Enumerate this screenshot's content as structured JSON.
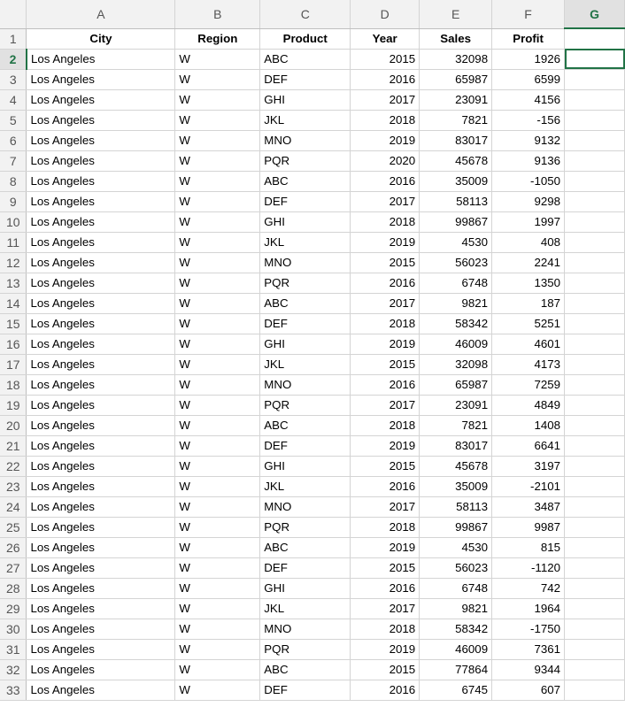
{
  "columns": [
    "A",
    "B",
    "C",
    "D",
    "E",
    "F",
    "G"
  ],
  "selected_column": "G",
  "selected_row": "2",
  "header": {
    "row": "1",
    "cells": [
      "City",
      "Region",
      "Product",
      "Year",
      "Sales",
      "Profit",
      ""
    ]
  },
  "rows": [
    {
      "n": "2",
      "cells": [
        "Los Angeles",
        "W",
        "ABC",
        "2015",
        "32098",
        "1926"
      ]
    },
    {
      "n": "3",
      "cells": [
        "Los Angeles",
        "W",
        "DEF",
        "2016",
        "65987",
        "6599"
      ]
    },
    {
      "n": "4",
      "cells": [
        "Los Angeles",
        "W",
        "GHI",
        "2017",
        "23091",
        "4156"
      ]
    },
    {
      "n": "5",
      "cells": [
        "Los Angeles",
        "W",
        "JKL",
        "2018",
        "7821",
        "-156"
      ]
    },
    {
      "n": "6",
      "cells": [
        "Los Angeles",
        "W",
        "MNO",
        "2019",
        "83017",
        "9132"
      ]
    },
    {
      "n": "7",
      "cells": [
        "Los Angeles",
        "W",
        "PQR",
        "2020",
        "45678",
        "9136"
      ]
    },
    {
      "n": "8",
      "cells": [
        "Los Angeles",
        "W",
        "ABC",
        "2016",
        "35009",
        "-1050"
      ]
    },
    {
      "n": "9",
      "cells": [
        "Los Angeles",
        "W",
        "DEF",
        "2017",
        "58113",
        "9298"
      ]
    },
    {
      "n": "10",
      "cells": [
        "Los Angeles",
        "W",
        "GHI",
        "2018",
        "99867",
        "1997"
      ]
    },
    {
      "n": "11",
      "cells": [
        "Los Angeles",
        "W",
        "JKL",
        "2019",
        "4530",
        "408"
      ]
    },
    {
      "n": "12",
      "cells": [
        "Los Angeles",
        "W",
        "MNO",
        "2015",
        "56023",
        "2241"
      ]
    },
    {
      "n": "13",
      "cells": [
        "Los Angeles",
        "W",
        "PQR",
        "2016",
        "6748",
        "1350"
      ]
    },
    {
      "n": "14",
      "cells": [
        "Los Angeles",
        "W",
        "ABC",
        "2017",
        "9821",
        "187"
      ]
    },
    {
      "n": "15",
      "cells": [
        "Los Angeles",
        "W",
        "DEF",
        "2018",
        "58342",
        "5251"
      ]
    },
    {
      "n": "16",
      "cells": [
        "Los Angeles",
        "W",
        "GHI",
        "2019",
        "46009",
        "4601"
      ]
    },
    {
      "n": "17",
      "cells": [
        "Los Angeles",
        "W",
        "JKL",
        "2015",
        "32098",
        "4173"
      ]
    },
    {
      "n": "18",
      "cells": [
        "Los Angeles",
        "W",
        "MNO",
        "2016",
        "65987",
        "7259"
      ]
    },
    {
      "n": "19",
      "cells": [
        "Los Angeles",
        "W",
        "PQR",
        "2017",
        "23091",
        "4849"
      ]
    },
    {
      "n": "20",
      "cells": [
        "Los Angeles",
        "W",
        "ABC",
        "2018",
        "7821",
        "1408"
      ]
    },
    {
      "n": "21",
      "cells": [
        "Los Angeles",
        "W",
        "DEF",
        "2019",
        "83017",
        "6641"
      ]
    },
    {
      "n": "22",
      "cells": [
        "Los Angeles",
        "W",
        "GHI",
        "2015",
        "45678",
        "3197"
      ]
    },
    {
      "n": "23",
      "cells": [
        "Los Angeles",
        "W",
        "JKL",
        "2016",
        "35009",
        "-2101"
      ]
    },
    {
      "n": "24",
      "cells": [
        "Los Angeles",
        "W",
        "MNO",
        "2017",
        "58113",
        "3487"
      ]
    },
    {
      "n": "25",
      "cells": [
        "Los Angeles",
        "W",
        "PQR",
        "2018",
        "99867",
        "9987"
      ]
    },
    {
      "n": "26",
      "cells": [
        "Los Angeles",
        "W",
        "ABC",
        "2019",
        "4530",
        "815"
      ]
    },
    {
      "n": "27",
      "cells": [
        "Los Angeles",
        "W",
        "DEF",
        "2015",
        "56023",
        "-1120"
      ]
    },
    {
      "n": "28",
      "cells": [
        "Los Angeles",
        "W",
        "GHI",
        "2016",
        "6748",
        "742"
      ]
    },
    {
      "n": "29",
      "cells": [
        "Los Angeles",
        "W",
        "JKL",
        "2017",
        "9821",
        "1964"
      ]
    },
    {
      "n": "30",
      "cells": [
        "Los Angeles",
        "W",
        "MNO",
        "2018",
        "58342",
        "-1750"
      ]
    },
    {
      "n": "31",
      "cells": [
        "Los Angeles",
        "W",
        "PQR",
        "2019",
        "46009",
        "7361"
      ]
    },
    {
      "n": "32",
      "cells": [
        "Los Angeles",
        "W",
        "ABC",
        "2015",
        "77864",
        "9344"
      ]
    },
    {
      "n": "33",
      "cells": [
        "Los Angeles",
        "W",
        "DEF",
        "2016",
        "6745",
        "607"
      ]
    }
  ]
}
